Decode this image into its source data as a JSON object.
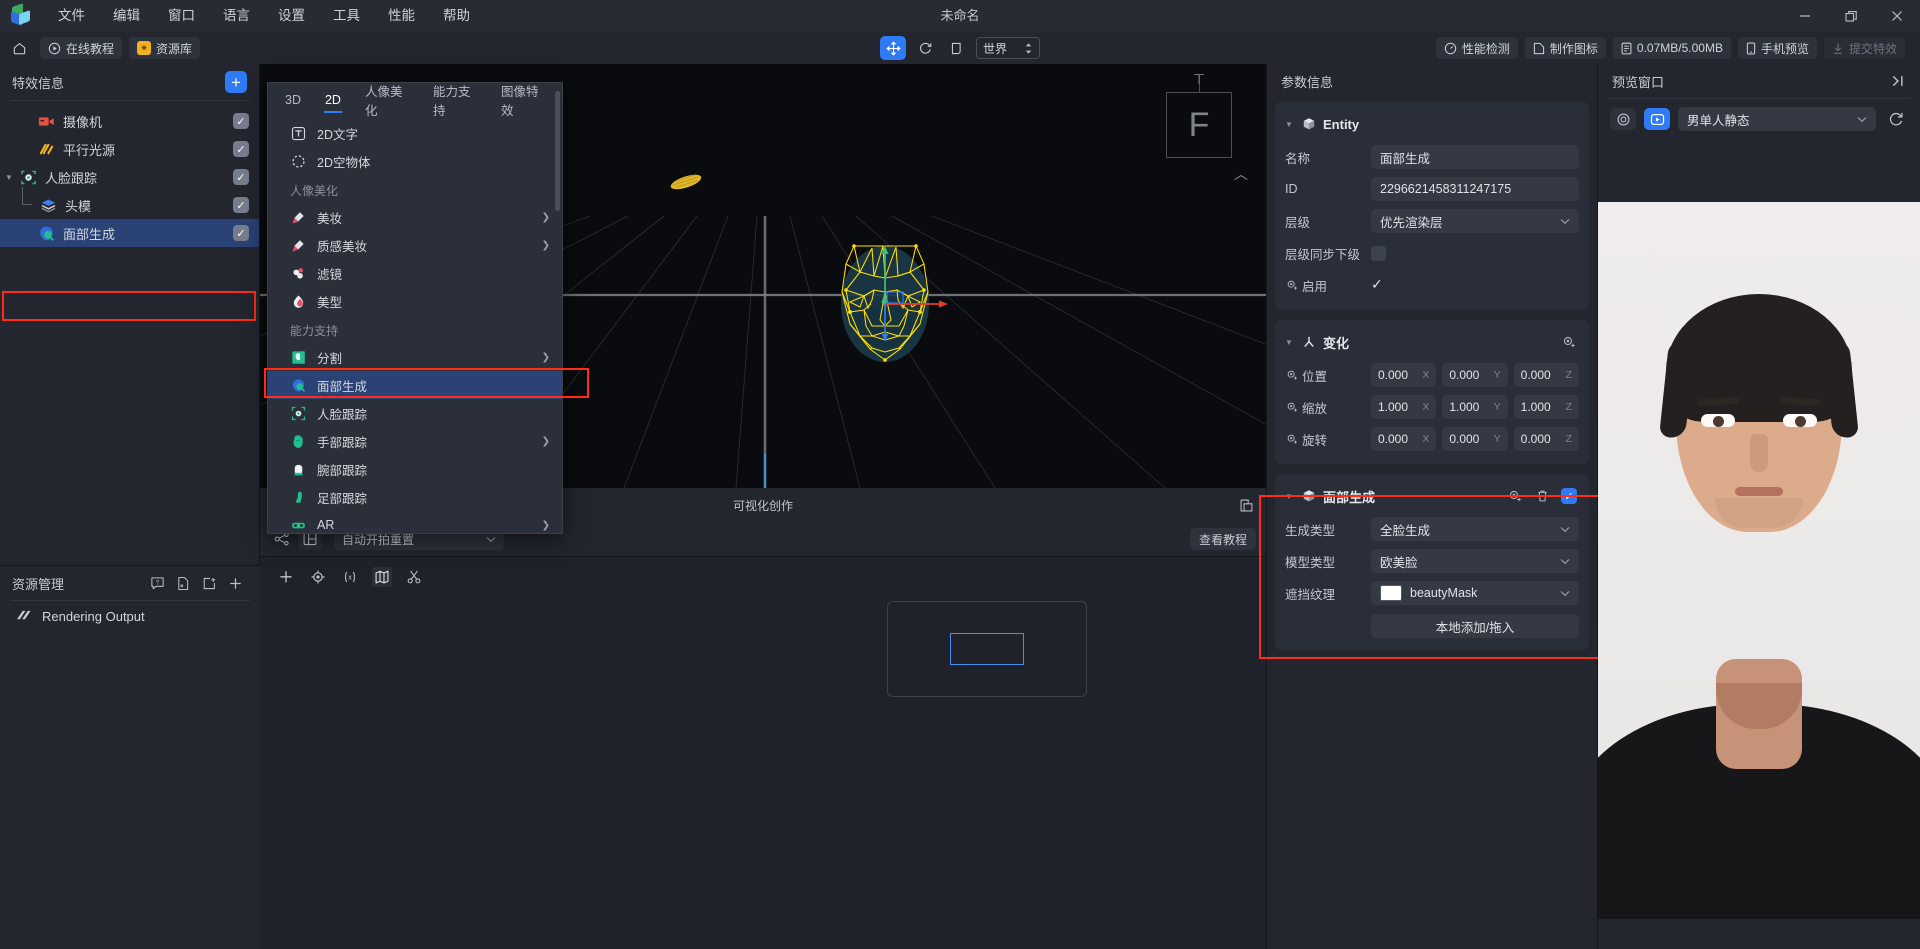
{
  "titlebar": {
    "menus": [
      "文件",
      "编辑",
      "窗口",
      "语言",
      "设置",
      "工具",
      "性能",
      "帮助"
    ],
    "doc_title": "未命名",
    "minimize": "—",
    "maximize": "❐",
    "close": "✕"
  },
  "toolbar": {
    "home_icon": "home-icon",
    "tutorial_label": "在线教程",
    "resources_label": "资源库",
    "move_tool": "move-tool-icon",
    "rotate_tool": "rotate-tool-icon",
    "scale_tool": "scale-tool-icon",
    "coord_space": "世界",
    "perf_label": "性能检测",
    "icon_label": "制作图标",
    "size_label": "0.07MB/5.00MB",
    "phone_label": "手机预览",
    "submit_label": "提交特效"
  },
  "left_panel": {
    "title": "特效信息",
    "add_button": "+",
    "tree": [
      {
        "label": "摄像机",
        "icon": "camera-icon",
        "indent": 1,
        "checked": true,
        "selected": false,
        "expander": ""
      },
      {
        "label": "平行光源",
        "icon": "directional-light-icon",
        "indent": 1,
        "checked": true,
        "selected": false,
        "expander": ""
      },
      {
        "label": "人脸跟踪",
        "icon": "face-track-icon",
        "indent": 0,
        "checked": true,
        "selected": false,
        "expander": "▼"
      },
      {
        "label": "头模",
        "icon": "head-model-icon",
        "indent": 2,
        "checked": true,
        "selected": false,
        "expander": ""
      },
      {
        "label": "面部生成",
        "icon": "face-gen-icon",
        "indent": 1,
        "checked": true,
        "selected": true,
        "expander": ""
      }
    ]
  },
  "resource_panel": {
    "title": "资源管理",
    "icons": [
      "help-icon",
      "import-file-icon",
      "new-folder-icon",
      "add-icon"
    ],
    "items": [
      {
        "label": "Rendering Output",
        "icon": "rendering-output-icon"
      }
    ]
  },
  "flyout": {
    "tabs": [
      {
        "label": "3D",
        "active": false
      },
      {
        "label": "2D",
        "active": true
      },
      {
        "label": "人像美化",
        "active": false
      },
      {
        "label": "能力支持",
        "active": false
      },
      {
        "label": "图像特效",
        "active": false
      }
    ],
    "items": [
      {
        "type": "item",
        "label": "2D文字",
        "icon": "text-2d-icon",
        "arrow": false,
        "highlight": false
      },
      {
        "type": "item",
        "label": "2D空物体",
        "icon": "empty-2d-icon",
        "arrow": false,
        "highlight": false
      },
      {
        "type": "group",
        "label": "人像美化"
      },
      {
        "type": "item",
        "label": "美妆",
        "icon": "makeup-icon",
        "arrow": true,
        "highlight": false
      },
      {
        "type": "item",
        "label": "质感美妆",
        "icon": "texture-makeup-icon",
        "arrow": true,
        "highlight": false
      },
      {
        "type": "item",
        "label": "滤镜",
        "icon": "filter-icon",
        "arrow": false,
        "highlight": false
      },
      {
        "type": "item",
        "label": "美型",
        "icon": "reshape-icon",
        "arrow": false,
        "highlight": false
      },
      {
        "type": "group",
        "label": "能力支持"
      },
      {
        "type": "item",
        "label": "分割",
        "icon": "segmentation-icon",
        "arrow": true,
        "highlight": false
      },
      {
        "type": "item",
        "label": "面部生成",
        "icon": "face-gen-icon",
        "arrow": false,
        "highlight": true
      },
      {
        "type": "item",
        "label": "人脸跟踪",
        "icon": "face-track-icon",
        "arrow": false,
        "highlight": false
      },
      {
        "type": "item",
        "label": "手部跟踪",
        "icon": "hand-track-icon",
        "arrow": true,
        "highlight": false
      },
      {
        "type": "item",
        "label": "腕部跟踪",
        "icon": "wrist-track-icon",
        "arrow": false,
        "highlight": false
      },
      {
        "type": "item",
        "label": "足部跟踪",
        "icon": "foot-track-icon",
        "arrow": false,
        "highlight": false
      },
      {
        "type": "item",
        "label": "AR",
        "icon": "ar-icon",
        "arrow": true,
        "highlight": false
      }
    ]
  },
  "viewport": {
    "gizmo_label": "F",
    "bottom_label": "可视化创作",
    "expand_icon": "expand-icon",
    "toolbar_icons": [
      "node-graph-icon",
      "layout-icon"
    ],
    "auto_reset": "自动开拍重置",
    "tutorial_btn": "查看教程",
    "timeline_icons": [
      "add-icon",
      "keyframe-icon",
      "expression-icon",
      "map-icon",
      "cut-icon"
    ]
  },
  "params": {
    "title": "参数信息",
    "entity": {
      "header": "Entity",
      "name_label": "名称",
      "name_value": "面部生成",
      "id_label": "ID",
      "id_value": "2296621458311247175",
      "layer_label": "层级",
      "layer_value": "优先渲染层",
      "layer_sync_label": "层级同步下级",
      "layer_sync_checked": false,
      "enable_label": "启用",
      "enable_checked": true
    },
    "transform": {
      "header": "变化",
      "position_label": "位置",
      "position": [
        "0.000",
        "0.000",
        "0.000"
      ],
      "scale_label": "缩放",
      "scale": [
        "1.000",
        "1.000",
        "1.000"
      ],
      "rotation_label": "旋转",
      "rotation": [
        "0.000",
        "0.000",
        "0.000"
      ],
      "axes": [
        "X",
        "Y",
        "Z"
      ]
    },
    "face_gen": {
      "header": "面部生成",
      "gen_type_label": "生成类型",
      "gen_type_value": "全脸生成",
      "model_type_label": "模型类型",
      "model_type_value": "欧美脸",
      "mask_label": "遮挡纹理",
      "mask_value": "beautyMask",
      "mask_color": "#ffffff",
      "add_button": "本地添加/拖入"
    }
  },
  "preview": {
    "title": "预览窗口",
    "collapse_icon": "collapse-right-icon",
    "camera_icon": "camera-toggle-icon",
    "video_icon": "video-toggle-icon",
    "source_value": "男单人静态",
    "refresh_icon": "refresh-icon"
  },
  "colors": {
    "accent": "#2f7bf6",
    "highlight_box": "#ff2d16",
    "selection": "#2a4275",
    "panel_bg": "#23262e",
    "card_bg": "#2a2e38"
  }
}
